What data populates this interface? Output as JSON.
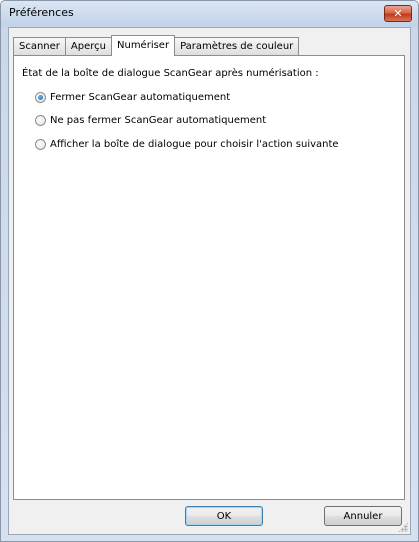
{
  "window": {
    "title": "Préférences",
    "close_symbol": "✕"
  },
  "tabs": [
    {
      "label": "Scanner",
      "active": false
    },
    {
      "label": "Aperçu",
      "active": false
    },
    {
      "label": "Numériser",
      "active": true
    },
    {
      "label": "Paramètres de couleur",
      "active": false
    }
  ],
  "panel": {
    "heading": "État de la boîte de dialogue ScanGear après numérisation :",
    "options": [
      {
        "label": "Fermer ScanGear automatiquement",
        "selected": true
      },
      {
        "label": "Ne pas fermer ScanGear automatiquement",
        "selected": false
      },
      {
        "label": "Afficher la boîte de dialogue pour choisir l'action suivante",
        "selected": false
      }
    ]
  },
  "buttons": {
    "ok_label": "OK",
    "cancel_label": "Annuler"
  },
  "icons": {
    "close": "close-icon",
    "radio_selected": "radio-selected-icon",
    "radio_unselected": "radio-unselected-icon",
    "resize_grip": "resize-grip-icon"
  },
  "colors": {
    "titlebar": "#c3d3e8",
    "close_button": "#c0391c",
    "default_button_border": "#3c7fb1",
    "radio_dot": "#1a5fa8"
  }
}
